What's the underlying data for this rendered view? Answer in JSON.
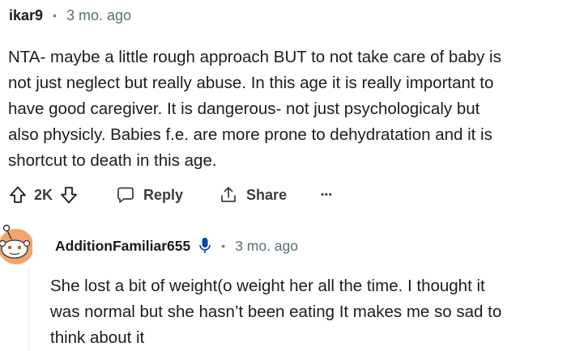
{
  "comment": {
    "username": "ikar9",
    "separator": "•",
    "time": "3 mo. ago",
    "lines": [
      "NTA- maybe a little rough approach BUT to not take care of baby is",
      "not just neglect but really abuse. In this age it is really important to",
      "have good caregiver. It is dangerous- not just psychologicaly but",
      "also physicly. Babies f.e. are more prone to dehydratation and it is",
      "shortcut to death in this age."
    ],
    "votes": "2K",
    "reply_label": "Reply",
    "share_label": "Share",
    "more_label": "•••"
  },
  "reply": {
    "username": "AdditionFamiliar655",
    "separator": "•",
    "time": "3 mo. ago",
    "lines": [
      "She lost a bit of weight(o weight her all the time. I thought it",
      "was normal but she hasn’t been eating It makes me so sad to",
      "think about it"
    ]
  },
  "icons": {
    "upvote": "upvote-icon",
    "downvote": "downvote-icon",
    "reply": "comment-bubble-icon",
    "share": "share-icon",
    "more": "more-options-icon",
    "mic": "microphone-icon",
    "avatar": "snoo-avatar"
  },
  "colors": {
    "text": "#1c1c1c",
    "meta": "#576f76",
    "avatar_bg": "#f3a56f",
    "mic": "#0045ac"
  }
}
